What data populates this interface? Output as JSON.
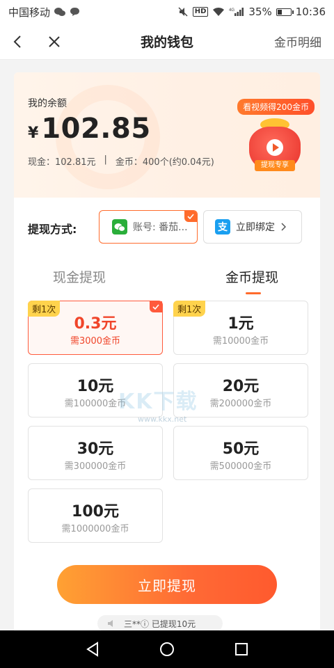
{
  "status_bar": {
    "carrier": "中国移动",
    "battery_text": "35%",
    "battery_level": 0.35,
    "time": "10:36",
    "network": "4G",
    "hd": "HD"
  },
  "nav": {
    "title": "我的钱包",
    "right_link": "金币明细"
  },
  "balance": {
    "label": "我的余额",
    "currency": "¥",
    "amount": "102.85",
    "cash_text": "现金：102.81元",
    "separator": "|",
    "coin_text": "金币：400个(约0.04元)",
    "promo_badge": "看视频得200金币",
    "promo_ribbon": "提现专享"
  },
  "method": {
    "label": "提现方式:",
    "wechat_text": "账号: 番茄...",
    "alipay_text": "立即绑定",
    "alipay_logo_char": "支"
  },
  "tabs": [
    {
      "label": "现金提现",
      "active": false
    },
    {
      "label": "金币提现",
      "active": true
    }
  ],
  "options": [
    {
      "amount": "0.3元",
      "need": "需3000金币",
      "tag": "剩1次",
      "selected": true
    },
    {
      "amount": "1元",
      "need": "需10000金币",
      "tag": "剩1次",
      "selected": false
    },
    {
      "amount": "10元",
      "need": "需100000金币",
      "tag": "",
      "selected": false
    },
    {
      "amount": "20元",
      "need": "需200000金币",
      "tag": "",
      "selected": false
    },
    {
      "amount": "30元",
      "need": "需300000金币",
      "tag": "",
      "selected": false
    },
    {
      "amount": "50元",
      "need": "需500000金币",
      "tag": "",
      "selected": false
    },
    {
      "amount": "100元",
      "need": "需1000000金币",
      "tag": "",
      "selected": false
    }
  ],
  "watermark": {
    "big": "KK下载",
    "small": "www.kkx.net"
  },
  "submit_label": "立即提现",
  "ticker_text": "三**ⓘ 已提现10元",
  "colors": {
    "accent": "#ff6b2c",
    "selected": "#f0452a",
    "tag": "#ffd34d"
  }
}
